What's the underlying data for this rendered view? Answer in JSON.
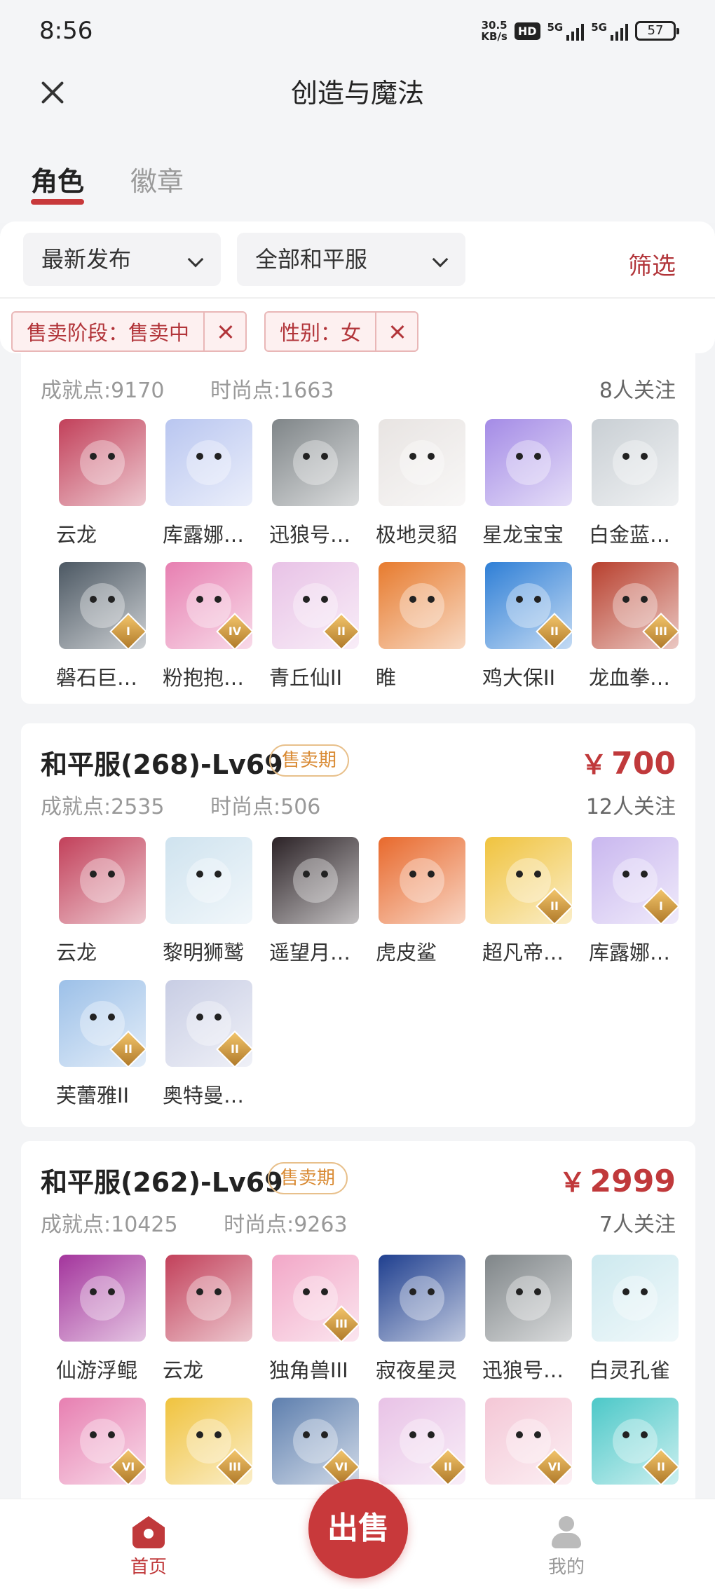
{
  "status_bar": {
    "time": "8:56",
    "net_speed_value": "30.5",
    "net_speed_unit": "KB/s",
    "hd": "HD",
    "sig1": "5G",
    "sig2": "5G",
    "battery": "57"
  },
  "header": {
    "title": "创造与魔法"
  },
  "tabs": {
    "active": "角色",
    "inactive": "徽章"
  },
  "filters": {
    "sort": "最新发布",
    "server": "全部和平服",
    "filter_label": "筛选",
    "tags": [
      "售卖阶段：售卖中",
      "性别：女"
    ]
  },
  "listings": [
    {
      "achievement": "成就点:9170",
      "fashion": "时尚点:1663",
      "followers": "8人关注",
      "pets": [
        {
          "name": "云龙",
          "color": "#c2405a",
          "rank": ""
        },
        {
          "name": "库露娜…",
          "color": "#b9c6f0",
          "rank": ""
        },
        {
          "name": "迅狼号…",
          "color": "#7f8588",
          "rank": ""
        },
        {
          "name": "极地灵貂",
          "color": "#e8e4e2",
          "rank": ""
        },
        {
          "name": "星龙宝宝",
          "color": "#a48be6",
          "rank": ""
        },
        {
          "name": "白金蓝…",
          "color": "#c9cfd4",
          "rank": ""
        },
        {
          "name": "磐石巨…",
          "color": "#4c5863",
          "rank": "I"
        },
        {
          "name": "粉抱抱…",
          "color": "#e77fb1",
          "rank": "IV"
        },
        {
          "name": "青丘仙II",
          "color": "#e8c2e6",
          "rank": "II"
        },
        {
          "name": "睢",
          "color": "#e77b2e",
          "rank": ""
        },
        {
          "name": "鸡大保II",
          "color": "#2f7fd6",
          "rank": "II"
        },
        {
          "name": "龙血拳…",
          "color": "#b8402e",
          "rank": "III"
        }
      ]
    },
    {
      "title": "和平服(268)-Lv69",
      "badge": "售卖期",
      "price_symbol": "￥",
      "price": "700",
      "achievement": "成就点:2535",
      "fashion": "时尚点:506",
      "followers": "12人关注",
      "pets": [
        {
          "name": "云龙",
          "color": "#c2405a",
          "rank": ""
        },
        {
          "name": "黎明狮鹫",
          "color": "#cfe3ef",
          "rank": ""
        },
        {
          "name": "遥望月…",
          "color": "#2b2226",
          "rank": ""
        },
        {
          "name": "虎皮鲨",
          "color": "#e8692c",
          "rank": ""
        },
        {
          "name": "超凡帝…",
          "color": "#f0c33e",
          "rank": "II"
        },
        {
          "name": "库露娜…",
          "color": "#c9b7ef",
          "rank": "I"
        },
        {
          "name": "芙蕾雅II",
          "color": "#9cc0e8",
          "rank": "II"
        },
        {
          "name": "奥特曼…",
          "color": "#c8cde4",
          "rank": "II"
        }
      ]
    },
    {
      "title": "和平服(262)-Lv69",
      "badge": "售卖期",
      "price_symbol": "￥",
      "price": "2999",
      "achievement": "成就点:10425",
      "fashion": "时尚点:9263",
      "followers": "7人关注",
      "pets": [
        {
          "name": "仙游浮鲲",
          "color": "#a3349c",
          "rank": ""
        },
        {
          "name": "云龙",
          "color": "#c2405a",
          "rank": ""
        },
        {
          "name": "独角兽III",
          "color": "#f2a7c7",
          "rank": "III"
        },
        {
          "name": "寂夜星灵",
          "color": "#1f3f8f",
          "rank": ""
        },
        {
          "name": "迅狼号…",
          "color": "#7f8588",
          "rank": ""
        },
        {
          "name": "白灵孔雀",
          "color": "#cde9ef",
          "rank": ""
        },
        {
          "name": "",
          "color": "#e77fb1",
          "rank": "VI"
        },
        {
          "name": "",
          "color": "#f0c33e",
          "rank": "III"
        },
        {
          "name": "",
          "color": "#5e7fae",
          "rank": "VI"
        },
        {
          "name": "",
          "color": "#e8c2e6",
          "rank": "II"
        },
        {
          "name": "",
          "color": "#f4c7d6",
          "rank": "VI"
        },
        {
          "name": "",
          "color": "#4cc8c8",
          "rank": "II"
        }
      ]
    }
  ],
  "bottom_nav": {
    "home": "首页",
    "sell": "出售",
    "me": "我的"
  },
  "colors": {
    "accent": "#c0393b",
    "badge": "#d98a33"
  }
}
